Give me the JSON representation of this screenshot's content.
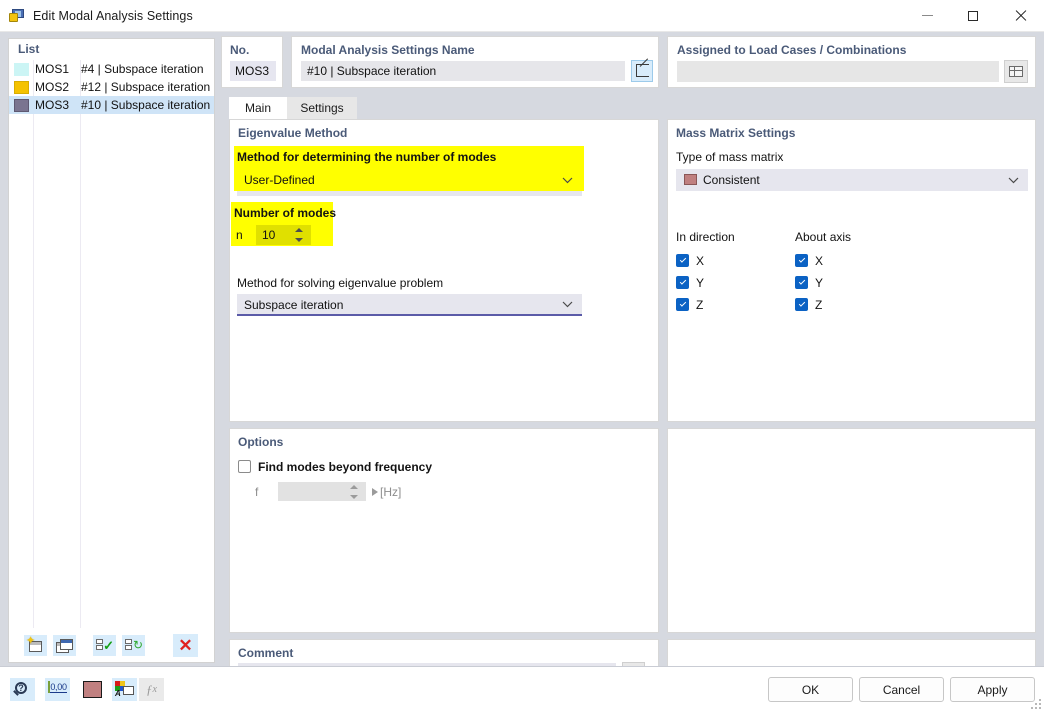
{
  "window": {
    "title": "Edit Modal Analysis Settings",
    "icon": "modal-analysis-icon",
    "minimize_label": "Minimize",
    "maximize_label": "Maximize",
    "close_label": "Close"
  },
  "list": {
    "header": "List",
    "rows": [
      {
        "color": "#ccf5f5",
        "code": "MOS1",
        "desc": "#4 | Subspace iteration",
        "selected": false
      },
      {
        "color": "#f5c200",
        "code": "MOS2",
        "desc": "#12 | Subspace iteration",
        "selected": false
      },
      {
        "color": "#7a7490",
        "code": "MOS3",
        "desc": "#10 | Subspace iteration",
        "selected": true
      }
    ],
    "toolbar": [
      {
        "name": "new-icon",
        "label": "New"
      },
      {
        "name": "copy-icon",
        "label": "Copy"
      },
      {
        "name": "select-all-icon",
        "label": "Select All"
      },
      {
        "name": "invert-selection-icon",
        "label": "Invert Selection"
      },
      {
        "name": "delete-icon",
        "label": "Delete"
      }
    ]
  },
  "header": {
    "no_label": "No.",
    "no_value": "MOS3",
    "name_label": "Modal Analysis Settings Name",
    "name_value": "#10 | Subspace iteration",
    "name_edit_icon": "edit-pencil-icon",
    "assigned_label": "Assigned to Load Cases / Combinations",
    "assigned_value": "",
    "assigned_icon": "table-select-icon"
  },
  "tabs": [
    {
      "label": "Main",
      "active": true
    },
    {
      "label": "Settings",
      "active": false
    }
  ],
  "eigenvalue": {
    "title": "Eigenvalue Method",
    "method_modes_label": "Method for determining the number of modes",
    "method_modes_value": "User-Defined",
    "number_of_modes_label": "Number of modes",
    "n_label": "n",
    "n_value": "10",
    "solver_label": "Method for solving eigenvalue problem",
    "solver_value": "Subspace iteration",
    "highlight_color": "#ffff00"
  },
  "mass_matrix": {
    "title": "Mass Matrix Settings",
    "type_label": "Type of mass matrix",
    "type_value": "Consistent",
    "type_swatch": "#c08080",
    "in_direction_label": "In direction",
    "about_axis_label": "About axis",
    "in_direction": [
      {
        "label": "X",
        "checked": true
      },
      {
        "label": "Y",
        "checked": true
      },
      {
        "label": "Z",
        "checked": true
      }
    ],
    "about_axis": [
      {
        "label": "X",
        "checked": true
      },
      {
        "label": "Y",
        "checked": true
      },
      {
        "label": "Z",
        "checked": true
      }
    ]
  },
  "options": {
    "title": "Options",
    "find_modes_label": "Find modes beyond frequency",
    "find_modes_checked": false,
    "f_label": "f",
    "f_value": "",
    "f_unit": "[Hz]"
  },
  "comment": {
    "title": "Comment",
    "value": "",
    "button_icon": "copy-comment-icon"
  },
  "bottom_toolbar": [
    {
      "name": "info-icon",
      "label": "Info",
      "disabled": false
    },
    {
      "name": "decimal-places-icon",
      "label": "0,00",
      "disabled": false
    },
    {
      "name": "color-swatch-icon",
      "label": "Color",
      "disabled": false,
      "color": "#c08080"
    },
    {
      "name": "display-properties-icon",
      "label": "Display Properties",
      "disabled": false
    },
    {
      "name": "formula-icon",
      "label": "Formula",
      "disabled": true
    }
  ],
  "dialog_buttons": [
    {
      "label": "OK",
      "name": "ok-button"
    },
    {
      "label": "Cancel",
      "name": "cancel-button"
    },
    {
      "label": "Apply",
      "name": "apply-button"
    }
  ]
}
